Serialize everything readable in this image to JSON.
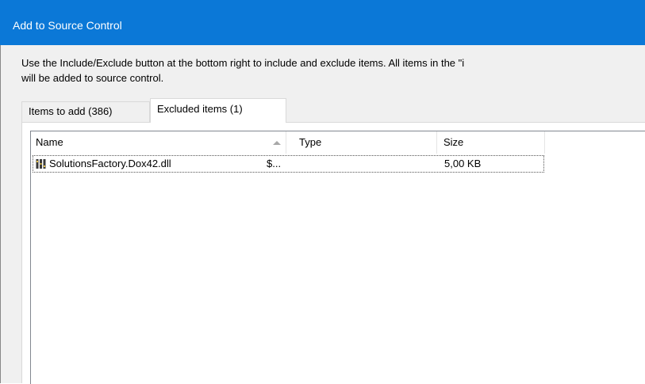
{
  "window": {
    "title": "Add to Source Control"
  },
  "instructions": {
    "line1": "Use the Include/Exclude button at the bottom right to include and exclude items. All items in the \"i",
    "line2": "will be added to source control."
  },
  "tabs": [
    {
      "label": "Items to add (386)",
      "active": false
    },
    {
      "label": "Excluded items (1)",
      "active": true
    }
  ],
  "list": {
    "columns": {
      "name": "Name",
      "type": "Type",
      "size": "Size"
    },
    "sort_icon": "sort-ascending-arrow",
    "rows": [
      {
        "icon": "dll-file-icon",
        "name": "SolutionsFactory.Dox42.dll",
        "extra": "$...",
        "type": "",
        "size": "5,00 KB"
      }
    ]
  },
  "colors": {
    "titlebar": "#0b78d7",
    "dialog_background": "#f0f0f0"
  }
}
